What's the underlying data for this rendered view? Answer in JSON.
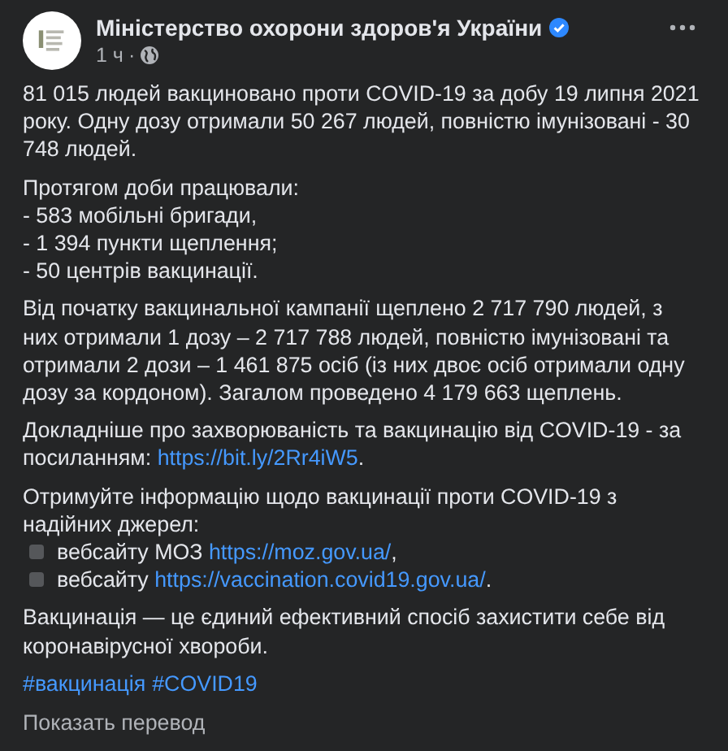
{
  "post": {
    "author": "Міністерство охорони здоров'я України",
    "verified": true,
    "time": "1 ч",
    "separator": "·"
  },
  "paragraphs": [
    {
      "lines": [
        {
          "bullet": false,
          "parts": [
            {
              "kind": "text",
              "text": "81 015 людей вакциновано проти COVID-19 за добу 19 липня 2021 року. Одну дозу отримали 50 267 людей, повністю імунізовані - 30 748 людей."
            }
          ]
        }
      ]
    },
    {
      "lines": [
        {
          "bullet": false,
          "parts": [
            {
              "kind": "text",
              "text": "Протягом доби працювали:"
            }
          ]
        },
        {
          "bullet": false,
          "parts": [
            {
              "kind": "text",
              "text": "- 583 мобільні бригади,"
            }
          ]
        },
        {
          "bullet": false,
          "parts": [
            {
              "kind": "text",
              "text": "- 1 394 пункти щеплення;"
            }
          ]
        },
        {
          "bullet": false,
          "parts": [
            {
              "kind": "text",
              "text": "- 50 центрів вакцинації."
            }
          ]
        }
      ]
    },
    {
      "lines": [
        {
          "bullet": false,
          "parts": [
            {
              "kind": "text",
              "text": "Від початку вакцинальної кампанії щеплено 2 717 790 людей, з них отримали 1 дозу – 2 717 788 людей, повністю імунізовані та отримали 2 дози – 1 461 875 осіб (із них двоє осіб отримали одну дозу за кордоном). Загалом проведено 4 179 663 щеплень."
            }
          ]
        }
      ]
    },
    {
      "lines": [
        {
          "bullet": false,
          "parts": [
            {
              "kind": "text",
              "text": "Докладніше про захворюваність та вакцинацію від COVID-19 - за посиланням: "
            },
            {
              "kind": "link",
              "text": "https://bit.ly/2Rr4iW5"
            },
            {
              "kind": "text",
              "text": "."
            }
          ]
        }
      ]
    },
    {
      "lines": [
        {
          "bullet": false,
          "parts": [
            {
              "kind": "text",
              "text": "Отримуйте інформацію щодо вакцинації проти COVID-19 з надійних джерел:"
            }
          ]
        },
        {
          "bullet": true,
          "parts": [
            {
              "kind": "text",
              "text": "вебсайту МОЗ "
            },
            {
              "kind": "link",
              "text": "https://moz.gov.ua/"
            },
            {
              "kind": "text",
              "text": ","
            }
          ]
        },
        {
          "bullet": true,
          "parts": [
            {
              "kind": "text",
              "text": "вебсайту "
            },
            {
              "kind": "link",
              "text": "https://vaccination.covid19.gov.ua/"
            },
            {
              "kind": "text",
              "text": "."
            }
          ]
        }
      ]
    },
    {
      "lines": [
        {
          "bullet": false,
          "parts": [
            {
              "kind": "text",
              "text": "Вакцинація — це єдиний ефективний спосіб захистити себе від коронавірусної хвороби."
            }
          ]
        }
      ]
    },
    {
      "lines": [
        {
          "bullet": false,
          "parts": [
            {
              "kind": "link",
              "text": "#вакцинація"
            },
            {
              "kind": "link",
              "text": "#COVID19"
            }
          ]
        }
      ]
    }
  ],
  "translate": "Показать перевод"
}
